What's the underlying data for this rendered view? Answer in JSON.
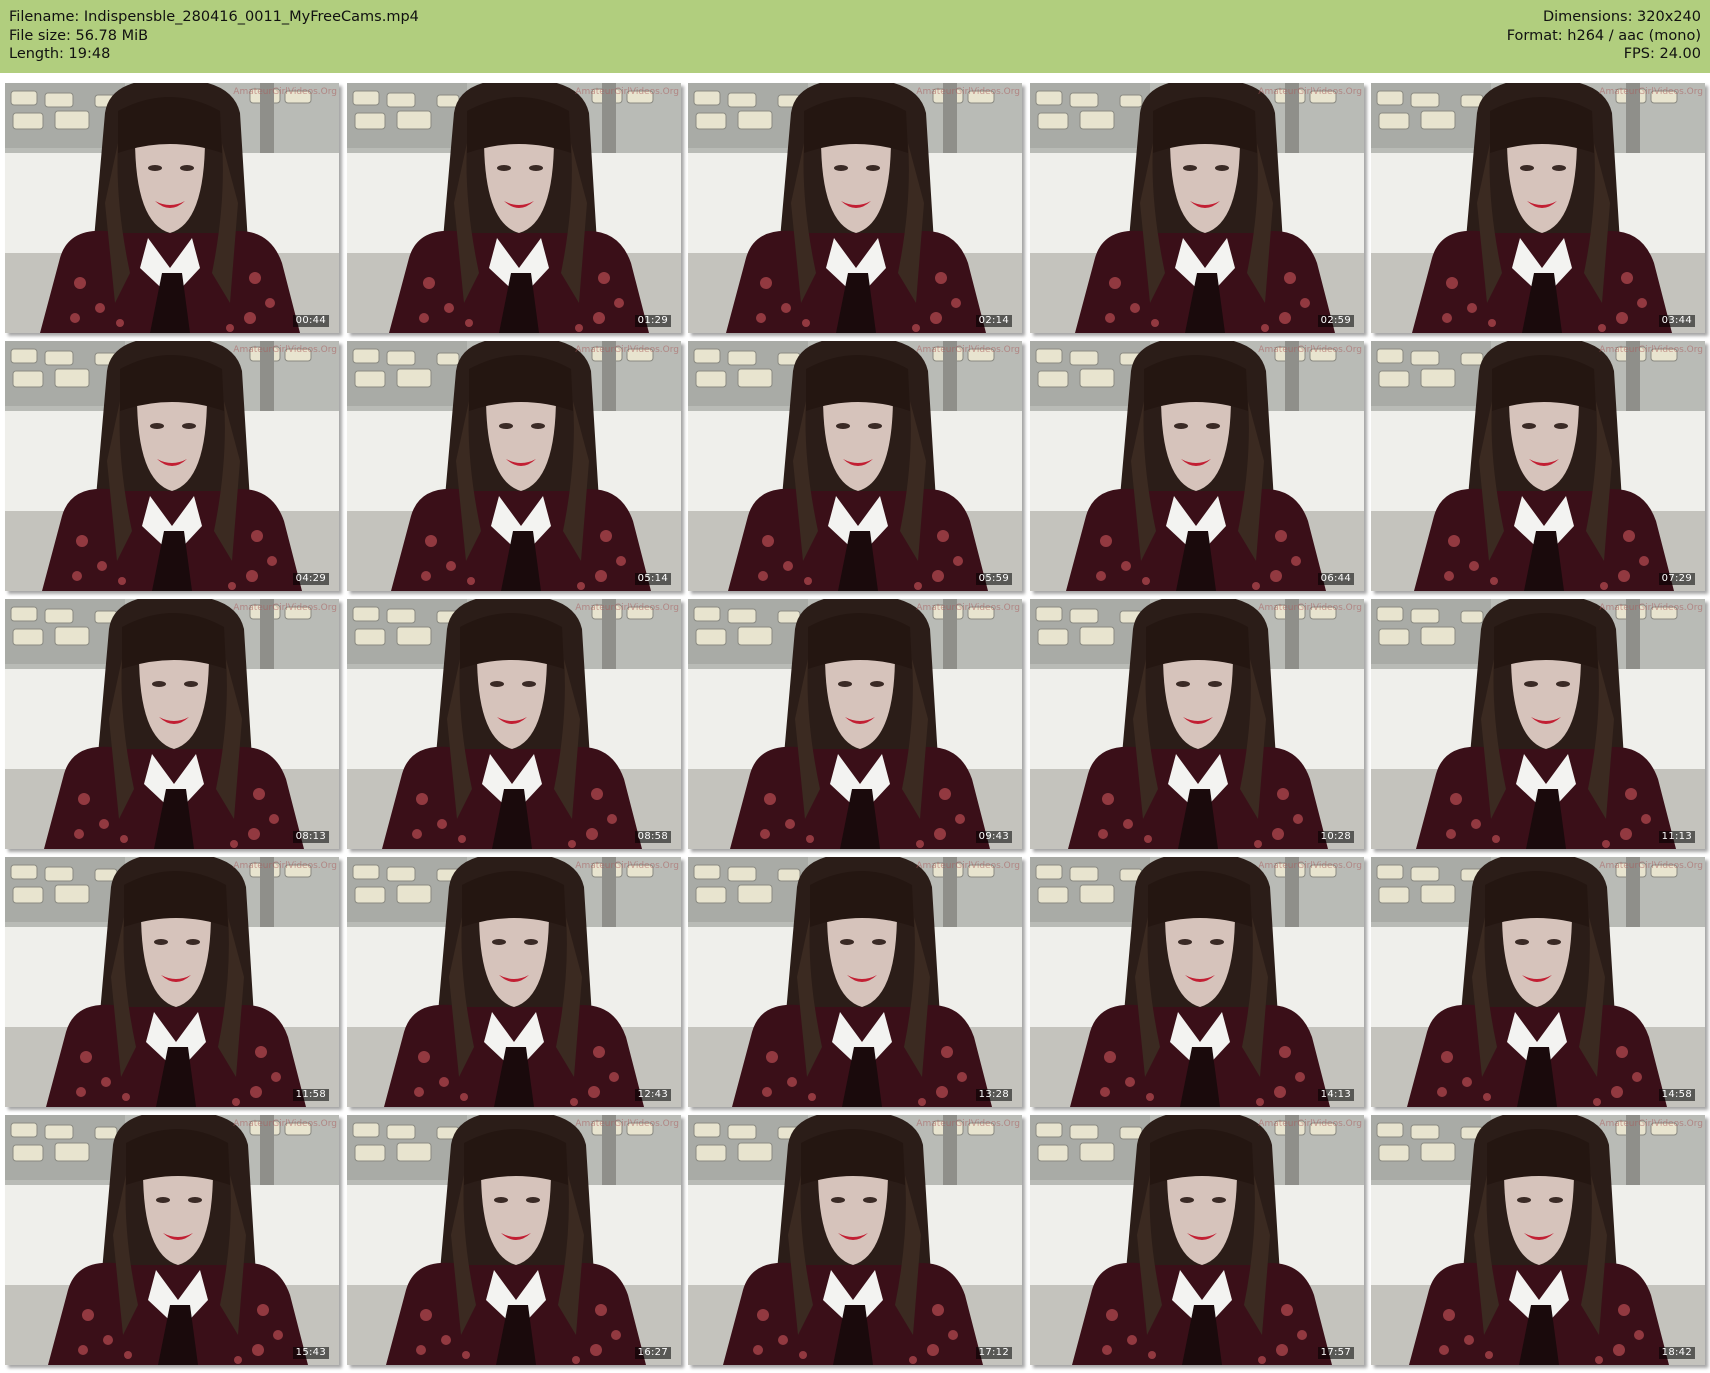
{
  "header": {
    "filename_label": "Filename: Indispensble_280416_0011_MyFreeCams.mp4",
    "filesize_label": "File size: 56.78 MiB",
    "length_label": "Length: 19:48",
    "dimensions_label": "Dimensions: 320x240",
    "format_label": "Format: h264 / aac (mono)",
    "fps_label": "FPS: 24.00",
    "background_color": "#b1ce7e"
  },
  "watermark": "AmateurGirlVideos.Org",
  "thumbnails": [
    {
      "timestamp": "00:44"
    },
    {
      "timestamp": "01:29"
    },
    {
      "timestamp": "02:14"
    },
    {
      "timestamp": "02:59"
    },
    {
      "timestamp": "03:44"
    },
    {
      "timestamp": "04:29"
    },
    {
      "timestamp": "05:14"
    },
    {
      "timestamp": "05:59"
    },
    {
      "timestamp": "06:44"
    },
    {
      "timestamp": "07:29"
    },
    {
      "timestamp": "08:13"
    },
    {
      "timestamp": "08:58"
    },
    {
      "timestamp": "09:43"
    },
    {
      "timestamp": "10:28"
    },
    {
      "timestamp": "11:13"
    },
    {
      "timestamp": "11:58"
    },
    {
      "timestamp": "12:43"
    },
    {
      "timestamp": "13:28"
    },
    {
      "timestamp": "14:13"
    },
    {
      "timestamp": "14:58"
    },
    {
      "timestamp": "15:43"
    },
    {
      "timestamp": "16:27"
    },
    {
      "timestamp": "17:12"
    },
    {
      "timestamp": "17:57"
    },
    {
      "timestamp": "18:42"
    }
  ]
}
